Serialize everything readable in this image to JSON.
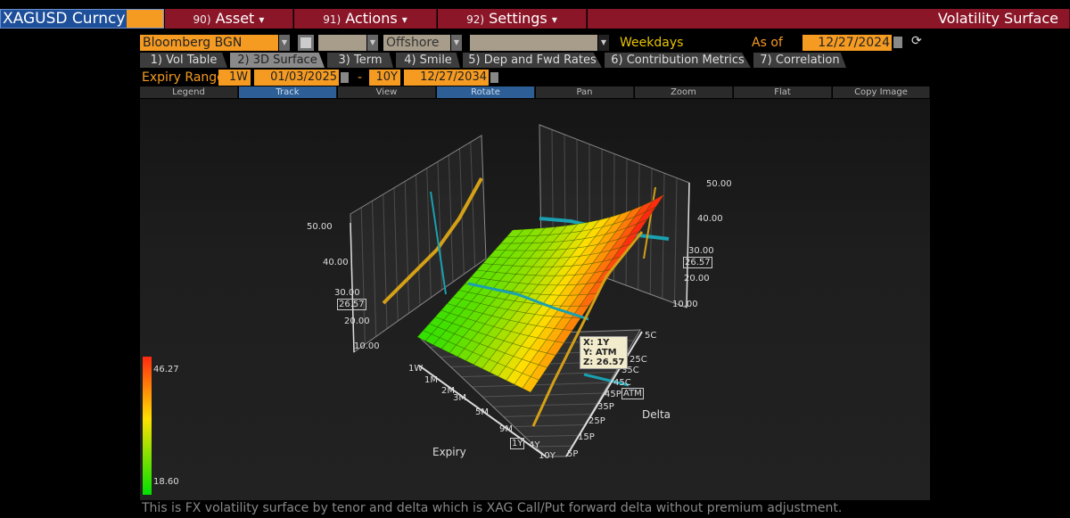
{
  "header": {
    "ticker": "XAGUSD Curncy",
    "menus": [
      {
        "num": "90)",
        "label": "Asset"
      },
      {
        "num": "91)",
        "label": "Actions"
      },
      {
        "num": "92)",
        "label": "Settings"
      }
    ],
    "title": "Volatility Surface"
  },
  "controls": {
    "source": "Bloomberg BGN",
    "field2": "",
    "location": "Offshore",
    "field4": "",
    "day_count": "Weekdays",
    "as_of_label": "As of",
    "as_of_date": "12/27/2024"
  },
  "tabs": [
    {
      "label": "1) Vol Table"
    },
    {
      "label": "2) 3D Surface",
      "active": true
    },
    {
      "label": "3) Term"
    },
    {
      "label": "4) Smile"
    },
    {
      "label": "5) Dep and Fwd Rates"
    },
    {
      "label": "6) Contribution Metrics"
    },
    {
      "label": "7) Correlation"
    }
  ],
  "expiry": {
    "label": "Expiry Range",
    "from_tenor": "1W",
    "from_date": "01/03/2025",
    "dash": "-",
    "to_tenor": "10Y",
    "to_date": "12/27/2034"
  },
  "toolbar": [
    {
      "label": "Legend"
    },
    {
      "label": "Track",
      "active": true
    },
    {
      "label": "View"
    },
    {
      "label": "Rotate",
      "active": true
    },
    {
      "label": "Pan"
    },
    {
      "label": "Zoom"
    },
    {
      "label": "Flat"
    },
    {
      "label": "Copy Image"
    }
  ],
  "chart": {
    "expiry_axis_title": "Expiry",
    "delta_axis_title": "Delta",
    "expiry_ticks": [
      "1W",
      "1M",
      "2M",
      "3M",
      "5M",
      "9M",
      "1Y",
      "4Y",
      "10Y"
    ],
    "delta_ticks": [
      "5C",
      "25C",
      "35C",
      "45C",
      "45P",
      "35P",
      "25P",
      "15P",
      "5P"
    ],
    "z_ticks": [
      "50.00",
      "40.00",
      "30.00",
      "20.00",
      "10.00"
    ],
    "track_value": "26.57",
    "track_expiry": "1Y",
    "track_delta": "ATM",
    "tooltip": {
      "x": "X: 1Y",
      "y": "Y: ATM",
      "z": "Z: 26.57"
    },
    "legend": {
      "max": "46.27",
      "min": "18.60",
      "colors": [
        "#ff2a10",
        "#ffe000",
        "#00e000"
      ]
    }
  },
  "caption": "This is FX volatility surface by tenor and delta which is XAG Call/Put forward delta without premium adjustment."
}
